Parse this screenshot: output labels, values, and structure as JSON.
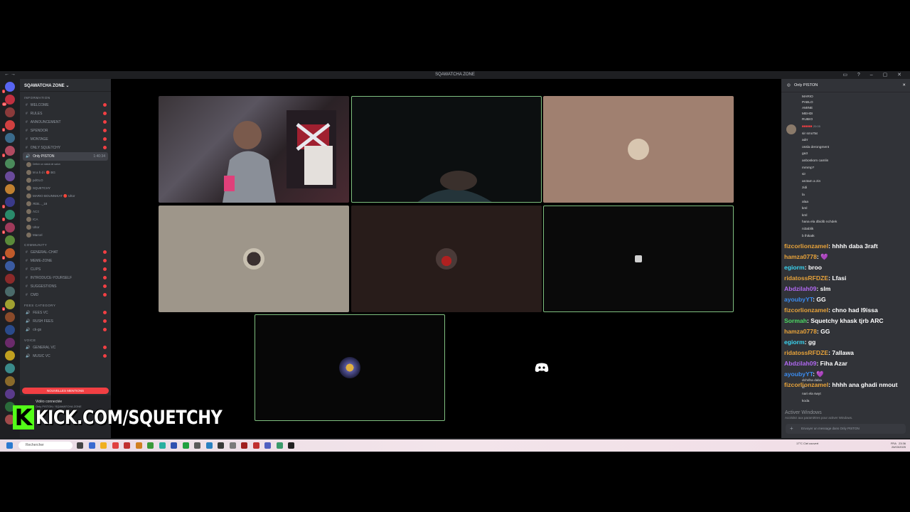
{
  "window": {
    "title": "SQAWATCHA ZONE",
    "nav": "← →",
    "controls": "▭ ? – ▢ ✕"
  },
  "server": {
    "name": "SQAWATCHA ZONE"
  },
  "servers_badges": [
    "1",
    "20",
    "",
    "4",
    "",
    "1",
    "",
    "",
    "",
    "1",
    "7",
    "3",
    "",
    "2",
    "",
    "",
    "",
    "4",
    "",
    "",
    "",
    "",
    "",
    "",
    "",
    "",
    ""
  ],
  "channels": {
    "cat_info": "INFORMATION",
    "info": [
      "WELCOME",
      "RULES",
      "ANNOUNCEMENT",
      "SPENDOR",
      "MONTAGE",
      "ONLY SQUETCHY"
    ],
    "voice_selected": "Only PISTON",
    "voice_selected_time": "1:40:34",
    "voice_selected_sub": "Définir un statut de salon",
    "voice_users": [
      "M a h d i  🔴 BG",
      "pdGLO",
      "SQUETCHY",
      "MARIO BOUNNIKAT  🔴 Ultor",
      "ЯΣB..._18",
      "ΛCΞ",
      "ICA",
      "Ultor",
      "Marcel"
    ],
    "cat_community": "COMMUNITY",
    "community": [
      "GENERAL-CHAT",
      "MEME-ZONE",
      "CLIPS",
      "INTRODUCE-YOURSELF",
      "SUGGESTIONS",
      "CMD"
    ],
    "cat_fees": "FEES CATEGORY",
    "fees": [
      "FEES VC",
      "RUSH FEES",
      "ck-gs"
    ],
    "cat_voice": "VOICE",
    "voice": [
      "GENERAL VC",
      "MUSIC VC"
    ],
    "mentions": "NOUVELLES MENTIONS",
    "voice_connected": "Vidéo connectée",
    "voice_connected_sub": "Only PISTON / SQAWATCHA ZONE"
  },
  "right_panel": {
    "title": "Only PISTON",
    "names": [
      "MARIO",
      "PABLO",
      "AMINE",
      "MEHDI",
      "RUBIO"
    ],
    "author_time": "20:05",
    "messages": [
      "sir smoTat",
      "adrr",
      "ossla derongment",
      "ga3",
      "anboskom camlin",
      "mmmp?",
      "sir",
      "an3am a zin",
      "zidi",
      "la",
      "alaa",
      "kml",
      "kml",
      "hana ela dbidib nchdek",
      "ni3ablik",
      "b lhikatk"
    ],
    "tail": [
      "dchriha daba",
      "sf",
      "nari ela swyt",
      "koda"
    ],
    "activate_1": "Activer Windows",
    "activate_2": "Accédez aux paramètres pour activer Windows.",
    "input_placeholder": "Envoyer un message dans Only PISTON"
  },
  "chat_overlay": [
    {
      "user": "fizcorlionzamel",
      "color": "#e8a33a",
      "text": "hhhh daba 3raft"
    },
    {
      "user": "hamza0778",
      "color": "#e8a33a",
      "text": "💜"
    },
    {
      "user": "egiorm",
      "color": "#3bd4f0",
      "text": "broo"
    },
    {
      "user": "ridatossRFDZE",
      "color": "#e8a33a",
      "text": "Lfasi"
    },
    {
      "user": "Abdzilah09",
      "color": "#b068f0",
      "text": "slm"
    },
    {
      "user": "ayoubyYT",
      "color": "#3b8cf0",
      "text": "GG"
    },
    {
      "user": "fizcorlionzamel",
      "color": "#e8a33a",
      "text": "chno had l9issa"
    },
    {
      "user": "Sormah",
      "color": "#4cd964",
      "text": "Squetchy khask tjrb ARC"
    },
    {
      "user": "hamza0778",
      "color": "#e8a33a",
      "text": "GG"
    },
    {
      "user": "egiorm",
      "color": "#3bd4f0",
      "text": "gg"
    },
    {
      "user": "ridatossRFDZE",
      "color": "#e8a33a",
      "text": "7allawa"
    },
    {
      "user": "Abdzilah09",
      "color": "#b068f0",
      "text": "Fiha Azar"
    },
    {
      "user": "ayoubyYT",
      "color": "#3b8cf0",
      "text": "💜"
    },
    {
      "user": "fizcorlionzamel",
      "color": "#e8a33a",
      "text": "hhhh ana ghadi nmout"
    }
  ],
  "kick": {
    "letter": "K",
    "url": "KICK.COM/SQUETCHY"
  },
  "taskbar": {
    "search": "Rechercher",
    "weather": "17°C Ciel couvert",
    "time": "23:36",
    "date": "26/03/2025",
    "lang": "FRA"
  },
  "colors": {
    "speaking": "#7fbf7f",
    "brand_kick": "#53fc18",
    "mention": "#f23f43"
  }
}
